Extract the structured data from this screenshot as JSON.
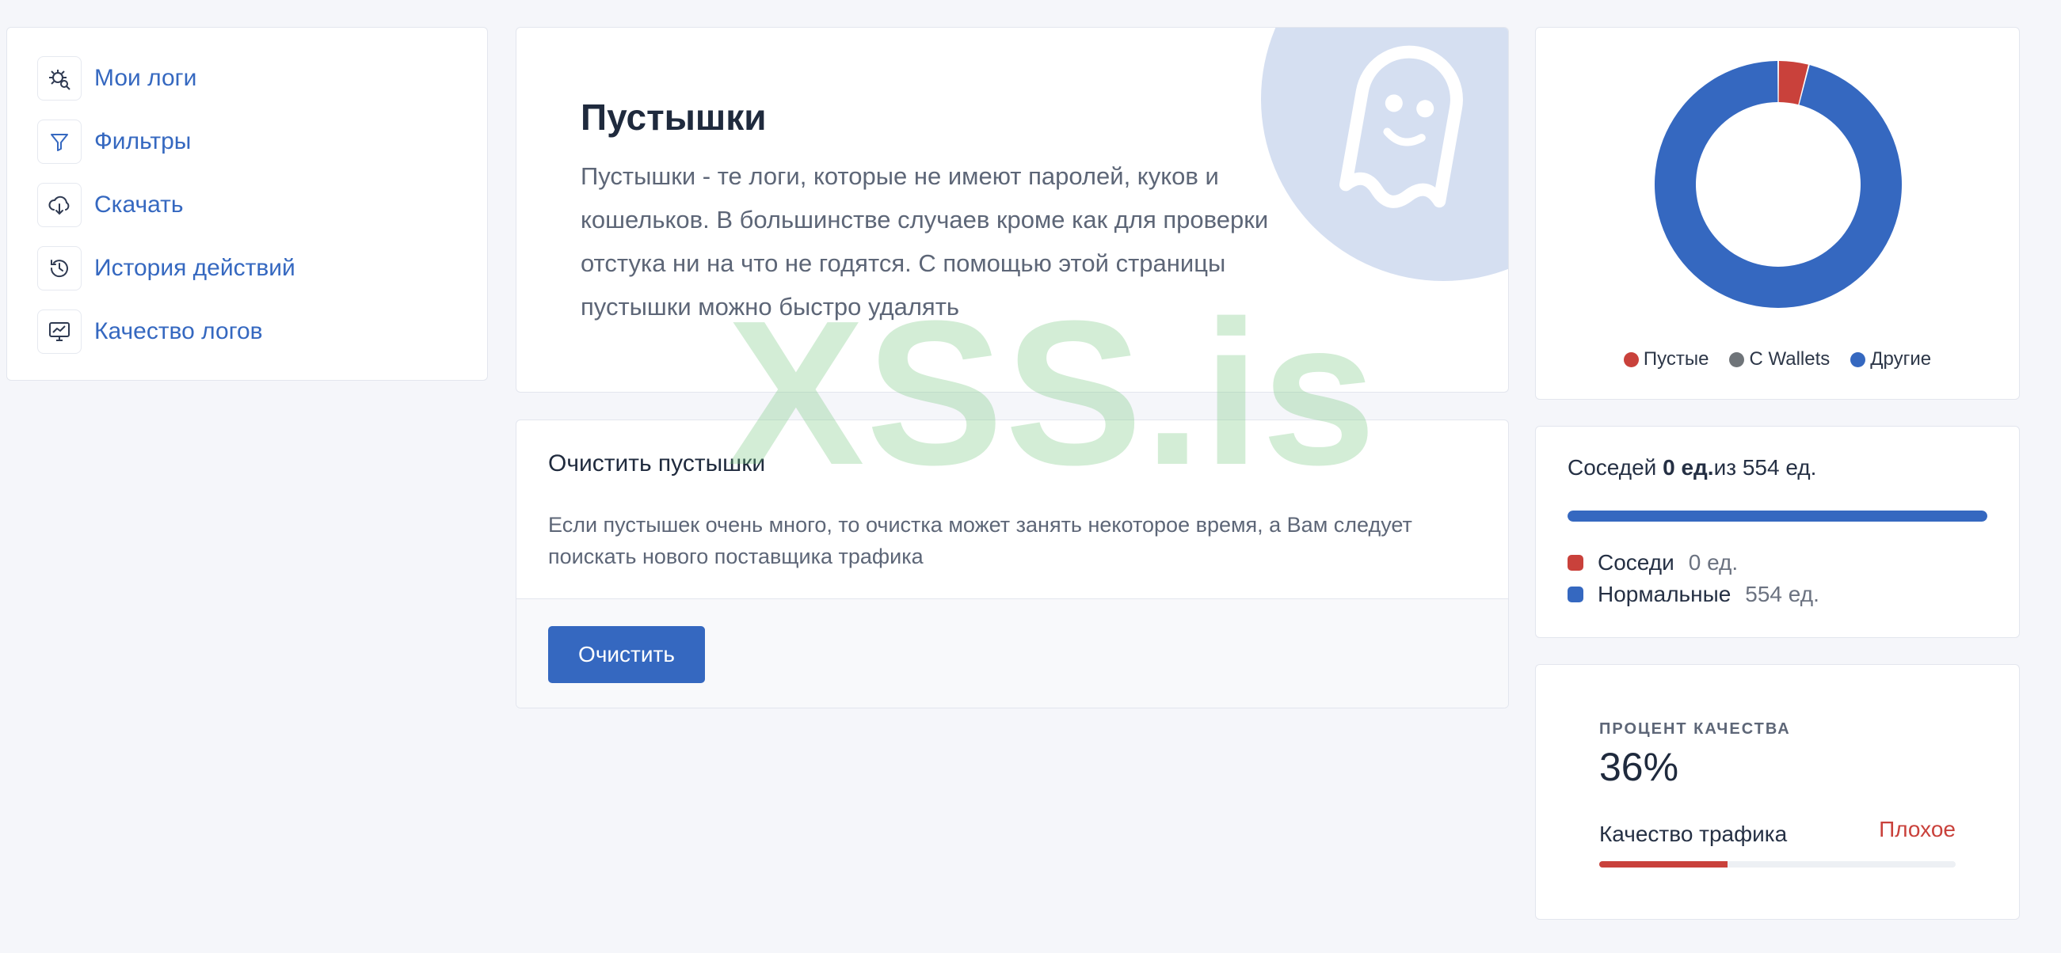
{
  "sidebar": {
    "items": [
      {
        "label": "Мои логи",
        "icon": "bug-search-icon"
      },
      {
        "label": "Фильтры",
        "icon": "filter-icon"
      },
      {
        "label": "Скачать",
        "icon": "cloud-download-icon"
      },
      {
        "label": "История действий",
        "icon": "history-icon"
      },
      {
        "label": "Качество логов",
        "icon": "monitor-chart-icon"
      }
    ]
  },
  "hero": {
    "title": "Пустышки",
    "text": "Пустышки - те логи, которые не имеют паролей, куков и кошельков. В большинстве случаев кроме как для проверки отстука ни на что не годятся. С помощью этой страницы пустышки можно быстро удалять",
    "icon": "ghost-icon"
  },
  "clean": {
    "title": "Очистить пустышки",
    "text": "Если пустышек очень много, то очистка может занять некоторое время, а Вам следует поискать нового поставщика трафика",
    "button_label": "Очистить"
  },
  "watermark": "XSS.is",
  "chart_data": {
    "type": "pie",
    "variant": "donut",
    "categories": [
      "Пустые",
      "C Wallets",
      "Другие"
    ],
    "values": [
      4,
      0,
      96
    ],
    "colors": [
      "#c9413b",
      "#6f7479",
      "#3568c0"
    ],
    "legend": "bottom"
  },
  "neighbors": {
    "prefix": "Соседей",
    "count_text": "0 ед.",
    "suffix": "из 554 ед.",
    "bar_fraction": 1.0,
    "rows": [
      {
        "name": "Соседи",
        "value": "0 ед.",
        "color": "#c9413b"
      },
      {
        "name": "Нормальные",
        "value": "554 ед.",
        "color": "#3568c0"
      }
    ]
  },
  "quality": {
    "caption": "ПРОЦЕНТ КАЧЕСТВА",
    "percent_text": "36%",
    "label": "Качество трафика",
    "status": "Плохое",
    "bar_fraction": 0.36
  }
}
